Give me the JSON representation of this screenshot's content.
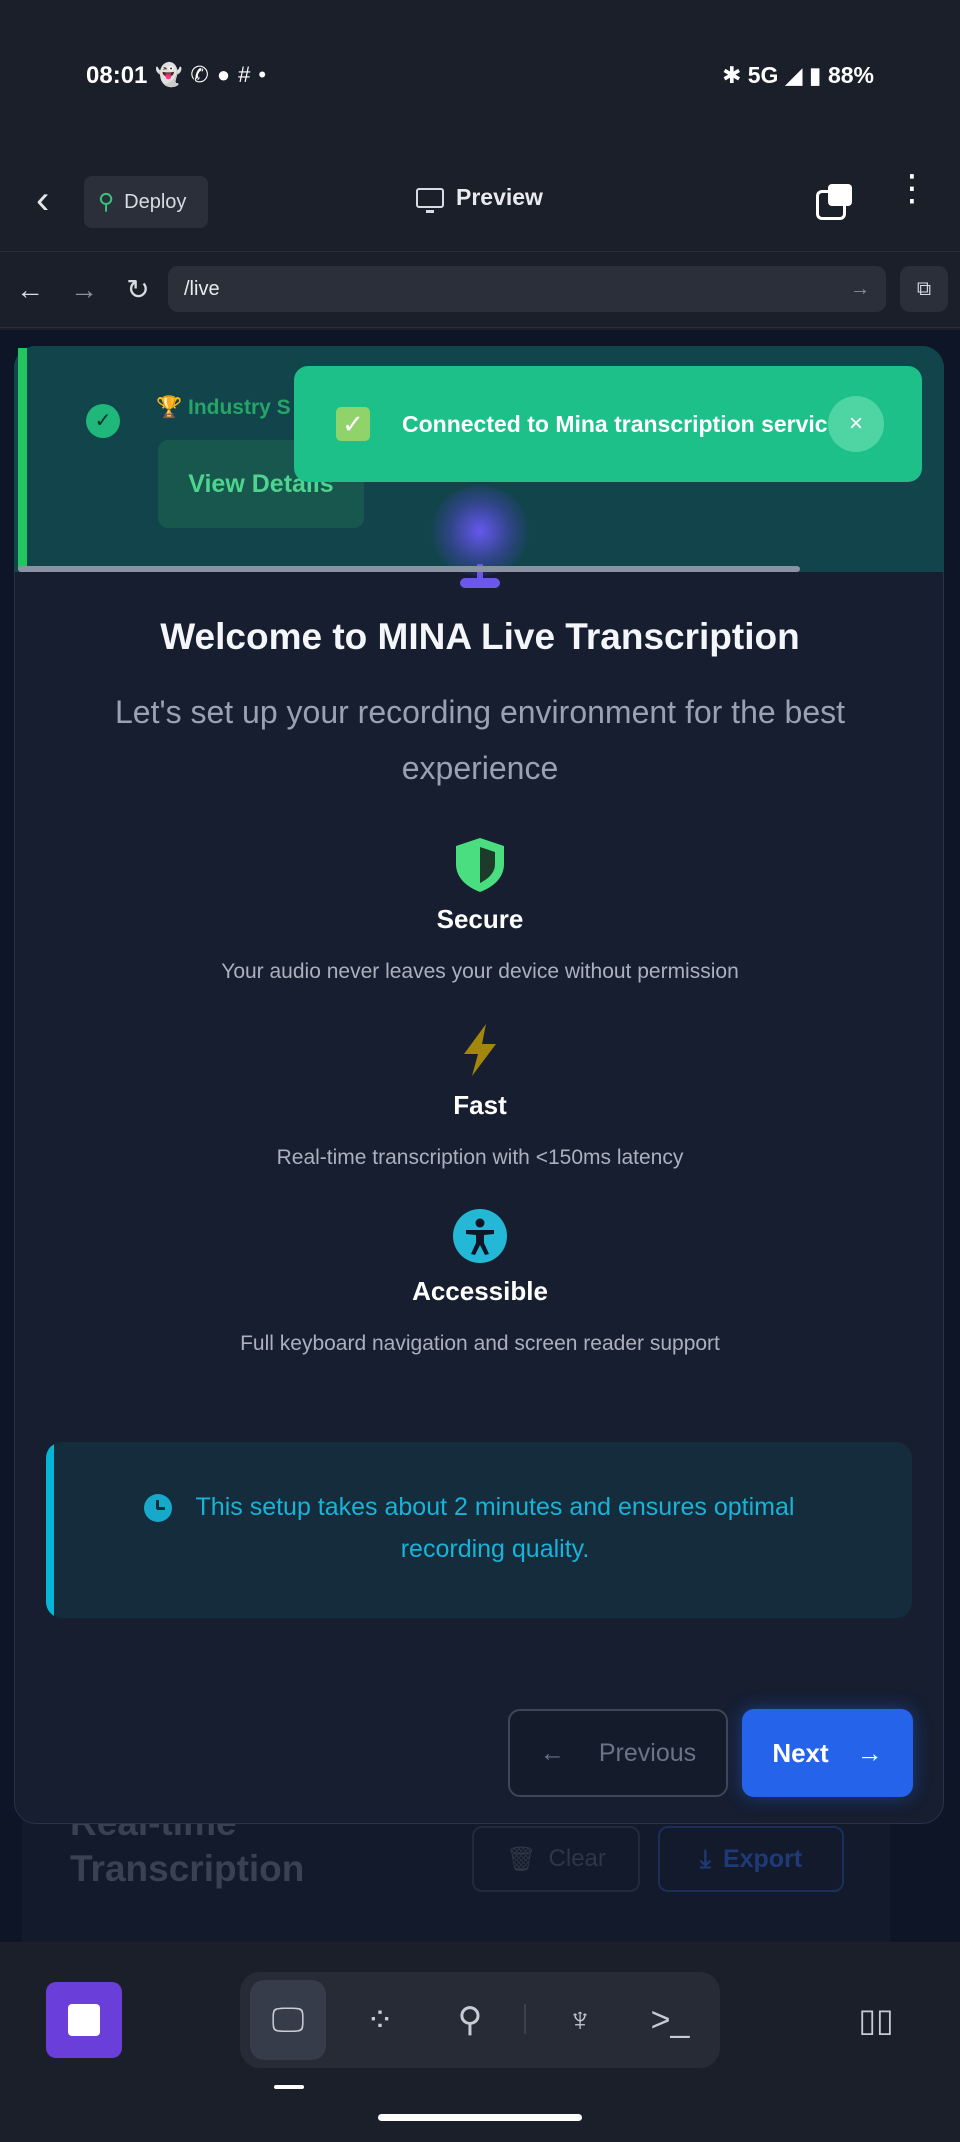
{
  "status_bar": {
    "time": "08:01",
    "left_icons": [
      "snapchat-icon",
      "whatsapp-icon",
      "chat-icon",
      "slack-icon",
      "dot-icon"
    ],
    "right_text": "5G",
    "battery": "88%"
  },
  "toolbar": {
    "deploy_label": "Deploy",
    "preview_label": "Preview"
  },
  "urlbar": {
    "url": "/live"
  },
  "toast": {
    "emoji": "✓",
    "message": "Connected to Mina transcription service",
    "close": "×"
  },
  "banner": {
    "industry_text": "🏆 Industry S",
    "view_details": "View Details",
    "colors": {
      "accent": "#22c55e",
      "toast": "#1ec08a"
    }
  },
  "welcome": {
    "title": "Welcome to MINA Live Transcription",
    "subtitle": "Let's set up your recording environment for the best experience"
  },
  "features": [
    {
      "icon": "shield-icon",
      "title": "Secure",
      "desc": "Your audio never leaves your device without permission"
    },
    {
      "icon": "lightning-icon",
      "title": "Fast",
      "desc": "Real-time transcription with <150ms latency"
    },
    {
      "icon": "accessibility-icon",
      "title": "Accessible",
      "desc": "Full keyboard navigation and screen reader support"
    }
  ],
  "info": {
    "text": "This setup takes about 2 minutes and ensures optimal recording quality."
  },
  "buttons": {
    "previous": "Previous",
    "next": "Next"
  },
  "background": {
    "title": "Real-time Transcription",
    "clear": "Clear",
    "export": "Export"
  },
  "bottom_nav": {
    "items": [
      "desktop-icon",
      "apps-icon",
      "deploy-icon",
      "shell-icon",
      "terminal-icon"
    ]
  }
}
